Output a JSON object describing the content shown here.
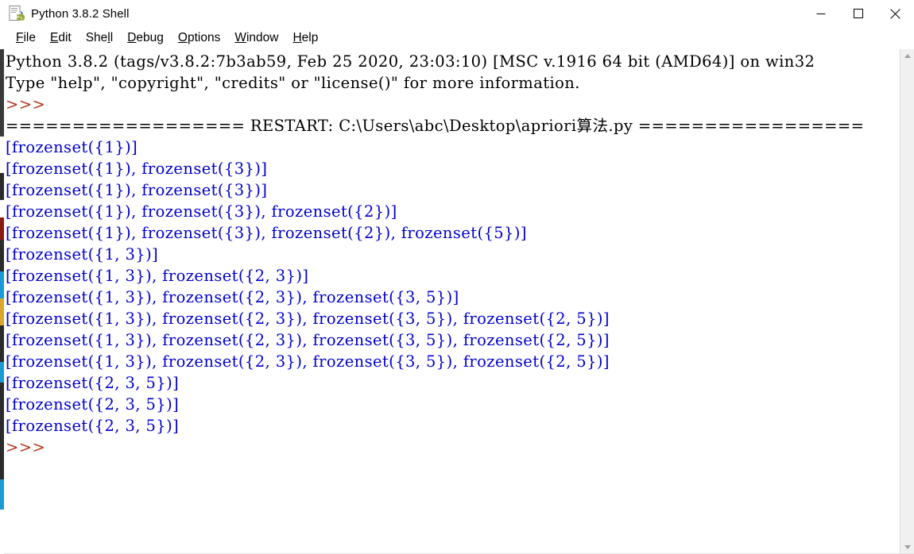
{
  "window": {
    "title": "Python 3.8.2 Shell",
    "icon": "python-idle-icon",
    "controls": {
      "minimize": "minimize-icon",
      "maximize": "maximize-icon",
      "close": "close-icon"
    }
  },
  "menubar": {
    "items": [
      {
        "label": "File",
        "accel": "F"
      },
      {
        "label": "Edit",
        "accel": "E"
      },
      {
        "label": "Shell",
        "accel": "l"
      },
      {
        "label": "Debug",
        "accel": "D"
      },
      {
        "label": "Options",
        "accel": "O"
      },
      {
        "label": "Window",
        "accel": "W"
      },
      {
        "label": "Help",
        "accel": "H"
      }
    ]
  },
  "colors": {
    "output_blue": "#0000cd",
    "prompt_brown": "#b03a20",
    "text_black": "#000000",
    "background": "#ffffff"
  },
  "console": {
    "lines": [
      {
        "type": "banner",
        "text": "Python 3.8.2 (tags/v3.8.2:7b3ab59, Feb 25 2020, 23:03:10) [MSC v.1916 64 bit (AMD64)] on win32"
      },
      {
        "type": "banner",
        "text": "Type \"help\", \"copyright\", \"credits\" or \"license()\" for more information."
      },
      {
        "type": "prompt",
        "text": ">>>"
      },
      {
        "type": "restart",
        "text": "================== RESTART: C:\\Users\\abc\\Desktop\\apriori算法.py ================="
      },
      {
        "type": "output",
        "text": "[frozenset({1})]"
      },
      {
        "type": "output",
        "text": "[frozenset({1}), frozenset({3})]"
      },
      {
        "type": "output",
        "text": "[frozenset({1}), frozenset({3})]"
      },
      {
        "type": "output",
        "text": "[frozenset({1}), frozenset({3}), frozenset({2})]"
      },
      {
        "type": "output",
        "text": "[frozenset({1}), frozenset({3}), frozenset({2}), frozenset({5})]"
      },
      {
        "type": "output",
        "text": "[frozenset({1, 3})]"
      },
      {
        "type": "output",
        "text": "[frozenset({1, 3}), frozenset({2, 3})]"
      },
      {
        "type": "output",
        "text": "[frozenset({1, 3}), frozenset({2, 3}), frozenset({3, 5})]"
      },
      {
        "type": "output",
        "text": "[frozenset({1, 3}), frozenset({2, 3}), frozenset({3, 5}), frozenset({2, 5})]"
      },
      {
        "type": "output",
        "text": "[frozenset({1, 3}), frozenset({2, 3}), frozenset({3, 5}), frozenset({2, 5})]"
      },
      {
        "type": "output",
        "text": "[frozenset({1, 3}), frozenset({2, 3}), frozenset({3, 5}), frozenset({2, 5})]"
      },
      {
        "type": "output",
        "text": "[frozenset({2, 3, 5})]"
      },
      {
        "type": "output",
        "text": "[frozenset({2, 3, 5})]"
      },
      {
        "type": "output",
        "text": "[frozenset({2, 3, 5})]"
      },
      {
        "type": "prompt",
        "text": ">>>"
      }
    ]
  },
  "scrollbar": {
    "up_arrow": "scroll-up-arrow-icon",
    "down_arrow": "scroll-down-arrow-icon"
  }
}
